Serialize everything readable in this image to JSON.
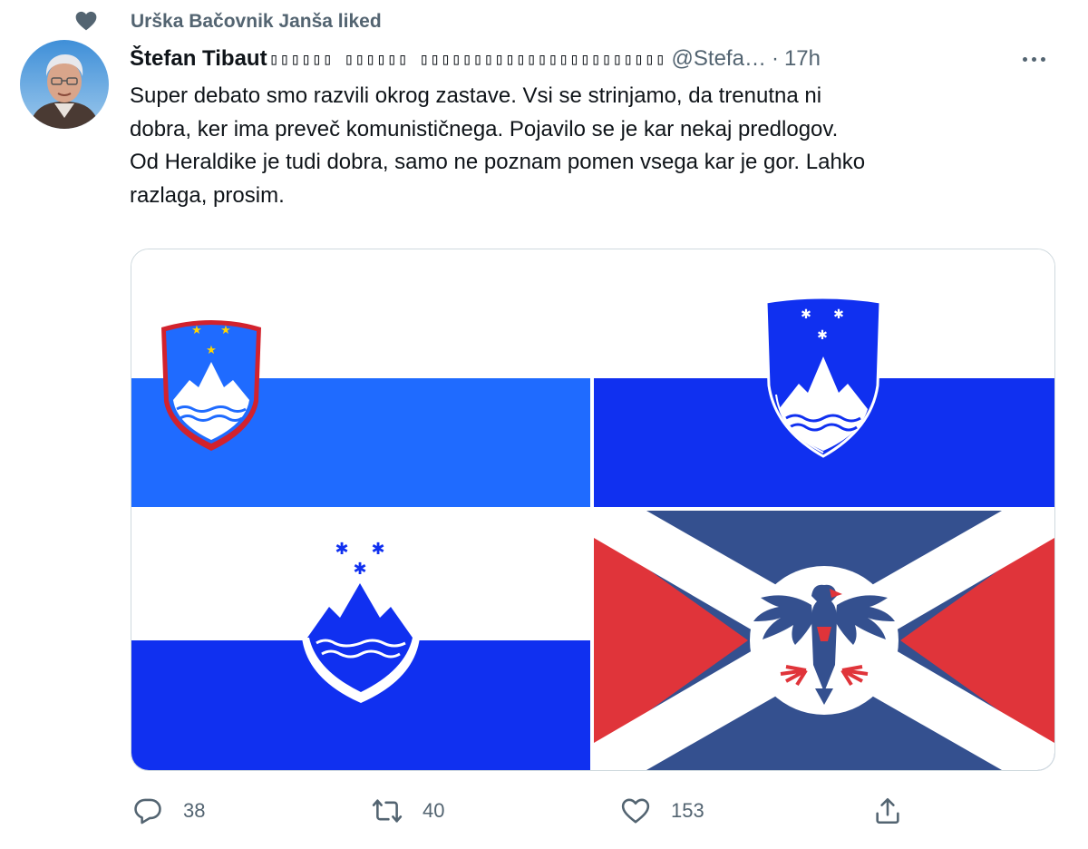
{
  "social_context": {
    "text": "Urška Bačovnik Janša liked"
  },
  "tweet": {
    "display_name": "Štefan Tibaut",
    "name_extra": "▯▯▯▯▯▯ ▯▯▯▯▯▯ ▯▯▯▯▯▯▯▯▯▯▯▯▯▯▯▯▯▯▯▯▯▯▯",
    "handle": "@Stefa…",
    "dot": "·",
    "time": "17h",
    "text": "Super debato smo razvili okrog zastave. Vsi se strinjamo, da trenutna ni\ndobra, ker ima preveč komunističnega. Pojavilo se je kar nekaj predlogov.\nOd Heraldike je tudi dobra, samo ne poznam pomen vsega kar je gor. Lahko\nrazlaga, prosim."
  },
  "media": {
    "flags": [
      {
        "name": "flag-red-border-shield",
        "colors": [
          "#ffffff",
          "#1f6bff",
          "#d2222d"
        ]
      },
      {
        "name": "flag-blue-shield",
        "colors": [
          "#ffffff",
          "#1030f0"
        ]
      },
      {
        "name": "flag-white-shield",
        "colors": [
          "#ffffff",
          "#1030f0"
        ]
      },
      {
        "name": "flag-saltire-eagle",
        "colors": [
          "#ffffff",
          "#34508f",
          "#e0343a"
        ]
      }
    ]
  },
  "actions": {
    "reply": {
      "icon": "reply-icon",
      "count": "38"
    },
    "retweet": {
      "icon": "retweet-icon",
      "count": "40"
    },
    "like": {
      "icon": "heart-icon",
      "count": "153"
    },
    "share": {
      "icon": "share-icon"
    }
  },
  "colors": {
    "text": "#0f1419",
    "secondary": "#536471",
    "border": "#cfd9de"
  }
}
